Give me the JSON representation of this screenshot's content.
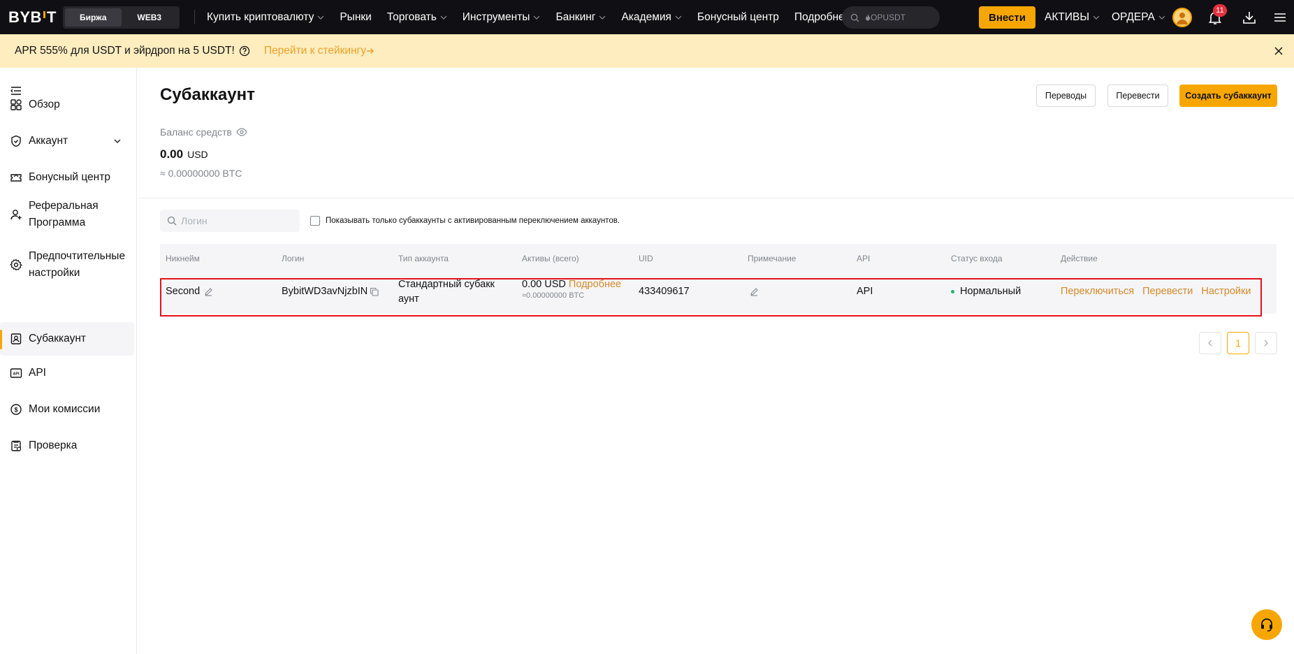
{
  "header": {
    "logo": "BYBIT",
    "segments": [
      "Биржа",
      "WEB3"
    ],
    "nav": [
      {
        "label": "Купить криптовалюту",
        "has_menu": true
      },
      {
        "label": "Рынки",
        "has_menu": false
      },
      {
        "label": "Торговать",
        "has_menu": true
      },
      {
        "label": "Инструменты",
        "has_menu": true
      },
      {
        "label": "Банкинг",
        "has_menu": true
      },
      {
        "label": "Академия",
        "has_menu": true
      },
      {
        "label": "Бонусный центр",
        "has_menu": false
      },
      {
        "label": "Подробнее",
        "has_menu": true
      }
    ],
    "search_placeholder": "OPUSDT",
    "deposit_label": "Внести",
    "assets_label": "АКТИВЫ",
    "orders_label": "ОРДЕРА",
    "notification_count": "11",
    "brand_color": "#f7a600"
  },
  "announcement": {
    "text": "APR 555% для USDT и эйрдроп на 5 USDT!",
    "link": "Перейти к стейкингу"
  },
  "sidebar": {
    "items": [
      {
        "label": "Обзор",
        "icon": "overview-icon"
      },
      {
        "label": "Аккаунт",
        "icon": "account-shield-icon"
      },
      {
        "label": "Бонусный центр",
        "icon": "ticket-icon"
      },
      {
        "label": "Реферальная",
        "label2": "Программа",
        "icon": "referral-icon"
      },
      {
        "label": "Предпочтительные",
        "label2": "настройки",
        "icon": "gear-icon"
      },
      {
        "label": "Субаккаунт",
        "icon": "subaccount-icon",
        "active": true
      },
      {
        "label": "API",
        "icon": "api-icon"
      },
      {
        "label": "Мои комиссии",
        "icon": "fees-icon"
      },
      {
        "label": "Проверка",
        "icon": "verification-icon"
      }
    ]
  },
  "main": {
    "title": "Субаккаунт",
    "buttons": {
      "transfers": "Переводы",
      "transfer": "Перевести",
      "create": "Создать субаккаунт"
    },
    "balance": {
      "label": "Баланс средств",
      "value": "0.00",
      "currency": "USD",
      "btc": "≈ 0.00000000 BTC"
    },
    "filter": {
      "placeholder": "Логин",
      "checkbox_label": "Показывать только субаккаунты с активированным переключением аккаунтов."
    },
    "table": {
      "headers": [
        "Никнейм",
        "Логин",
        "Тип аккаунта",
        "Активы (всего)",
        "UID",
        "Примечание",
        "API",
        "Статус входа",
        "Действие"
      ],
      "rows": [
        {
          "nickname": "Second",
          "login": "BybitWD3avNjzbIN",
          "type_line1": "Стандартный субакк",
          "type_line2": "аунт",
          "assets": "0.00 USD",
          "assets_more": "Подробнее",
          "assets_btc": "≈0.00000000 BTC",
          "uid": "433409617",
          "api": "API",
          "status": "Нормальный",
          "actions": [
            "Переключиться",
            "Перевести",
            "Настройки"
          ]
        }
      ]
    },
    "pagination": {
      "current": "1"
    }
  }
}
